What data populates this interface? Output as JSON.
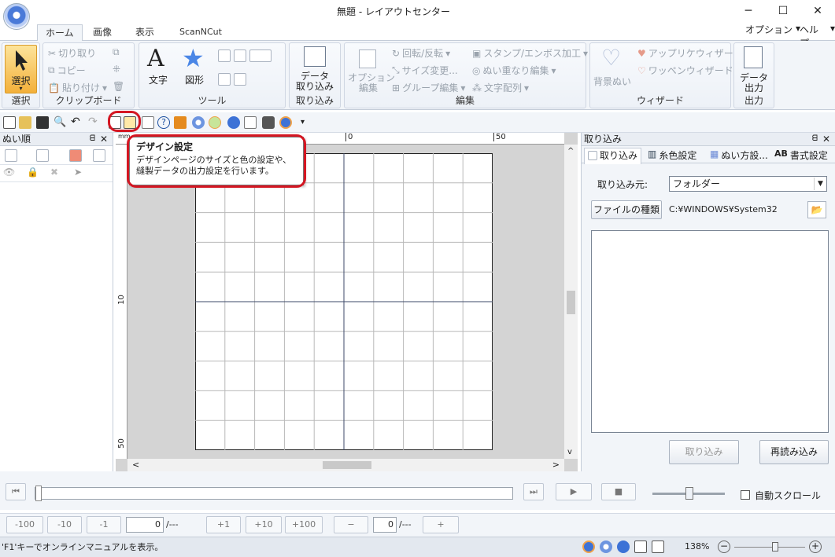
{
  "title": "無題 - レイアウトセンター",
  "window": {
    "minimize": "─",
    "maximize": "☐",
    "close": "✕"
  },
  "tabs": [
    "ホーム",
    "画像",
    "表示",
    "ScanNCut"
  ],
  "menu_right": {
    "options": "オプション",
    "help": "ヘルプ",
    "arrow": "▾",
    "help_arrow": "▾"
  },
  "ribbon": {
    "select": {
      "label": "選択",
      "group": "選択"
    },
    "clipboard": {
      "cut": "切り取り",
      "copy": "コピー",
      "paste": "貼り付け",
      "group": "クリップボード"
    },
    "tools": {
      "text": "文字",
      "shape": "図形",
      "group": "ツール"
    },
    "import": {
      "data_import": "データ\n取り込み",
      "group": "取り込み"
    },
    "edit": {
      "option_edit": "オプション\n編集",
      "rotate": "回転/反転",
      "resize": "サイズ変更...",
      "group_edit": "グループ編集",
      "stamp": "スタンプ/エンボス加工",
      "stitch_overlap": "ぬい重なり編集",
      "text_arrange": "文字配列",
      "group": "編集"
    },
    "wizard": {
      "bg_stitch": "背景ぬい",
      "applique": "アップリケウィザード",
      "patch": "ワッペンウィザード",
      "group": "ウィザード"
    },
    "output": {
      "data_output": "データ\n出力",
      "group": "出力"
    }
  },
  "tooltip": {
    "title": "デザイン設定",
    "body": "デザインページのサイズと色の設定や、縫製データの出力設定を行います。"
  },
  "left_panel": {
    "title": "ぬい順",
    "pin": "ᗺ",
    "close": "✕"
  },
  "ruler": {
    "unit": "mm",
    "h0": "0",
    "h50": "50",
    "v10": "10",
    "v50": "50"
  },
  "right_panel": {
    "title": "取り込み",
    "pin": "ᗺ",
    "close": "✕",
    "tabs": [
      "取り込み",
      "糸色設定",
      "ぬい方設...",
      "書式設定"
    ],
    "source_label": "取り込み元:",
    "source_value": "フォルダー",
    "file_type_button": "ファイルの種類",
    "path": "C:¥WINDOWS¥System32",
    "import_button": "取り込み",
    "reload_button": "再読み込み"
  },
  "playback": {
    "auto_scroll": "自動スクロール"
  },
  "stitch_nav": {
    "m100": "-100",
    "m10": "-10",
    "m1": "-1",
    "value": "0",
    "total": "/---",
    "p1": "+1",
    "p10": "+10",
    "p100": "+100",
    "minus": "−",
    "plus": "+",
    "obj_value": "0",
    "obj_total": "/---"
  },
  "status": {
    "message": "'F1'キーでオンラインマニュアルを表示。",
    "zoom": "138%"
  },
  "colors": {
    "accent_blue": "#2a64c8",
    "annotation_red": "#d41622",
    "select_orange": "#f3b03a"
  }
}
